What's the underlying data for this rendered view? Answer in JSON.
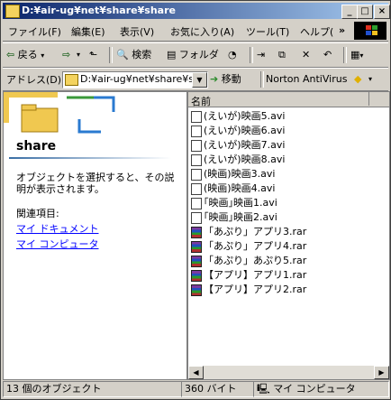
{
  "window": {
    "title": "D:¥air-ug¥net¥share¥share"
  },
  "titlebar_buttons": {
    "minimize": "_",
    "maximize": "□",
    "close": "×"
  },
  "menu": [
    "ファイル(F)",
    "編集(E)",
    "表示(V)",
    "お気に入り(A)",
    "ツール(T)",
    "ヘルプ(",
    "»"
  ],
  "toolbar": {
    "back": "戻る",
    "back_arrow": "⇦",
    "forward_arrow": "⇨",
    "up": "⬑",
    "search": "検索",
    "folder": "フォルダ",
    "history": "◔",
    "move_to": "⇥",
    "copy_to": "⧉",
    "delete": "✕",
    "undo": "↶",
    "views": "▦"
  },
  "address_bar": {
    "label": "アドレス(D)",
    "value": "D:¥air-ug¥net¥share¥sha",
    "go": "移動",
    "go_icon": "➔",
    "norton": "Norton AntiVirus",
    "norton_icon": "◆",
    "dropdown_arrow": "▼"
  },
  "left_pane": {
    "folder_name": "share",
    "description": "オブジェクトを選択すると、その説明が表示されます。",
    "related_heading": "関連項目:",
    "links": [
      "マイ ドキュメント",
      "マイ コンピュータ"
    ]
  },
  "file_list": {
    "column_header": "名前",
    "files": [
      {
        "name": "(えいが)映画5.avi",
        "type": "avi"
      },
      {
        "name": "(えいが)映画6.avi",
        "type": "avi"
      },
      {
        "name": "(えいが)映画7.avi",
        "type": "avi"
      },
      {
        "name": "(えいが)映画8.avi",
        "type": "avi"
      },
      {
        "name": "(映画)映画3.avi",
        "type": "avi"
      },
      {
        "name": "(映画)映画4.avi",
        "type": "avi"
      },
      {
        "name": "｢映画｣映画1.avi",
        "type": "avi"
      },
      {
        "name": "｢映画｣映画2.avi",
        "type": "avi"
      },
      {
        "name": "「あぷり」アプリ3.rar",
        "type": "rar"
      },
      {
        "name": "「あぷり」アプリ4.rar",
        "type": "rar"
      },
      {
        "name": "「あぷり」あぷり5.rar",
        "type": "rar"
      },
      {
        "name": "【アプリ】アプリ1.rar",
        "type": "rar"
      },
      {
        "name": "【アプリ】アプリ2.rar",
        "type": "rar"
      }
    ]
  },
  "scrollbar": {
    "left": "◀",
    "right": "▶"
  },
  "status_bar": {
    "count": "13 個のオブジェクト",
    "size": "360 バイト",
    "location": "マイ コンピュータ"
  },
  "colors": {
    "title_start": "#0a246a",
    "title_end": "#a6caf0",
    "link": "#0000ff"
  }
}
